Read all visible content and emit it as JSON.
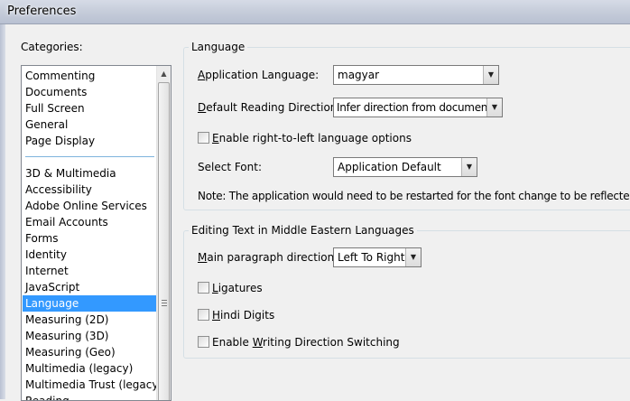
{
  "window": {
    "title": "Preferences"
  },
  "categories": {
    "label": "Categories:",
    "items": [
      {
        "label": "Commenting"
      },
      {
        "label": "Documents"
      },
      {
        "label": "Full Screen"
      },
      {
        "label": "General"
      },
      {
        "label": "Page Display"
      },
      {
        "label": "3D & Multimedia"
      },
      {
        "label": "Accessibility"
      },
      {
        "label": "Adobe Online Services"
      },
      {
        "label": "Email Accounts"
      },
      {
        "label": "Forms"
      },
      {
        "label": "Identity"
      },
      {
        "label": "Internet"
      },
      {
        "label": "JavaScript"
      },
      {
        "label": "Language",
        "selected": true
      },
      {
        "label": "Measuring (2D)"
      },
      {
        "label": "Measuring (3D)"
      },
      {
        "label": "Measuring (Geo)"
      },
      {
        "label": "Multimedia (legacy)"
      },
      {
        "label": "Multimedia Trust (legacy)"
      },
      {
        "label": "Reading"
      }
    ]
  },
  "language": {
    "group_title": "Language",
    "app_language": {
      "label_pre": "",
      "label_u": "A",
      "label_post": "pplication Language:",
      "value": "magyar"
    },
    "reading_direction": {
      "label_pre": "",
      "label_u": "D",
      "label_post": "efault Reading Direction:",
      "value": "Infer direction from document"
    },
    "rtl_options": {
      "label_pre": "",
      "label_u": "E",
      "label_post": "nable right-to-left language options",
      "checked": false
    },
    "select_font": {
      "label": "Select Font:",
      "value": "Application Default"
    },
    "note": "Note: The application would need to be restarted for the font change to be reflected."
  },
  "middle_eastern": {
    "group_title": "Editing Text in Middle Eastern Languages",
    "paragraph_direction": {
      "label_pre": "",
      "label_u": "M",
      "label_post": "ain paragraph direction:",
      "value": "Left To Right"
    },
    "ligatures": {
      "label_pre": "",
      "label_u": "L",
      "label_post": "igatures",
      "checked": false
    },
    "hindi_digits": {
      "label_pre": "",
      "label_u": "H",
      "label_post": "indi Digits",
      "checked": false
    },
    "writing_direction": {
      "label_pre": "Enable ",
      "label_u": "W",
      "label_post": "riting Direction Switching",
      "checked": false
    }
  }
}
